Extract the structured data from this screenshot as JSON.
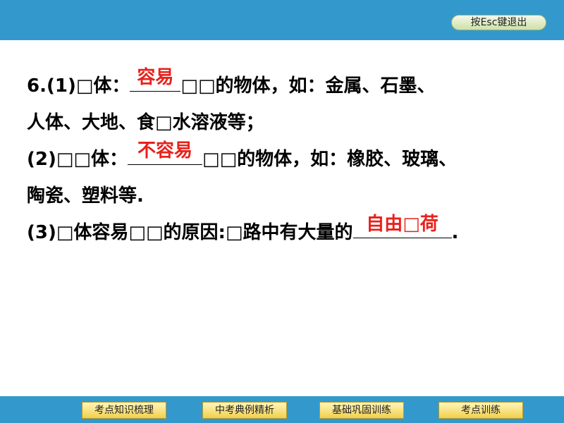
{
  "header": {
    "esc_button_label": "按Esc键退出"
  },
  "question": {
    "line1_prefix": "6.(1)□体：",
    "line1_answer": "容易",
    "line1_suffix": "□□的物体，如：金属、石墨、",
    "line2": "人体、大地、食□水溶液等；",
    "line3_prefix": "(2)□□体：",
    "line3_answer": "不容易",
    "line3_suffix": "□□的物体，如：橡胶、玻璃、",
    "line4": "陶瓷、塑料等.",
    "line5_prefix": "(3)□体容易□□的原因:□路中有大量的",
    "line5_answer": "自由□荷",
    "line5_suffix": "."
  },
  "footer": {
    "nav": [
      "考点知识梳理",
      "中考典例精析",
      "基础巩固训练",
      "考点训练"
    ]
  },
  "colors": {
    "accent": "#3399cc",
    "answer": "#e8211b",
    "nav_button": "#f2d04a"
  }
}
